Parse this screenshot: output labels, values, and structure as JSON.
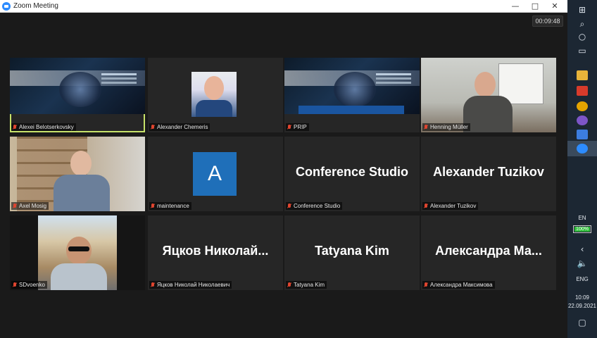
{
  "window": {
    "title": "Zoom Meeting",
    "timer": "00:09:48",
    "controls": {
      "minimize": "—",
      "maximize": "□",
      "close": "✕"
    }
  },
  "participants": [
    {
      "name": "Alexei Belotserkovsky",
      "muted": true,
      "video": "slide",
      "active": true
    },
    {
      "name": "Alexander Chemeris",
      "muted": true,
      "video": "photo"
    },
    {
      "name": "PRIP",
      "muted": true,
      "video": "slide"
    },
    {
      "name": "Henning Müller",
      "muted": true,
      "video": "camera"
    },
    {
      "name": "Axel Mosig",
      "muted": true,
      "video": "camera"
    },
    {
      "name": "maintenance",
      "muted": true,
      "video": "avatar",
      "avatar_letter": "A"
    },
    {
      "name": "Conference Studio",
      "muted": true,
      "video": "off",
      "big_name": "Conference Studio"
    },
    {
      "name": "Alexander Tuzikov",
      "muted": true,
      "video": "off",
      "big_name": "Alexander Tuzikov"
    },
    {
      "name": "SDvoenko",
      "muted": true,
      "video": "camera"
    },
    {
      "name": "Яцков Николай Николаевич",
      "muted": true,
      "video": "off",
      "big_name": "Яцков  Николай..."
    },
    {
      "name": "Tatyana Kim",
      "muted": true,
      "video": "off",
      "big_name": "Tatyana Kim"
    },
    {
      "name": "Александра Максимова",
      "muted": true,
      "video": "off",
      "big_name": "Александра  Ма..."
    }
  ],
  "taskbar": {
    "language_short": "EN",
    "battery_percent": "100%",
    "battery_level": 1.0,
    "input_language": "ENG",
    "time": "10:09",
    "date": "22.09.2021"
  },
  "colors": {
    "active_speaker": "#c7e26a",
    "avatar": "#1f6fb9",
    "muted_mic": "#e0452f"
  }
}
